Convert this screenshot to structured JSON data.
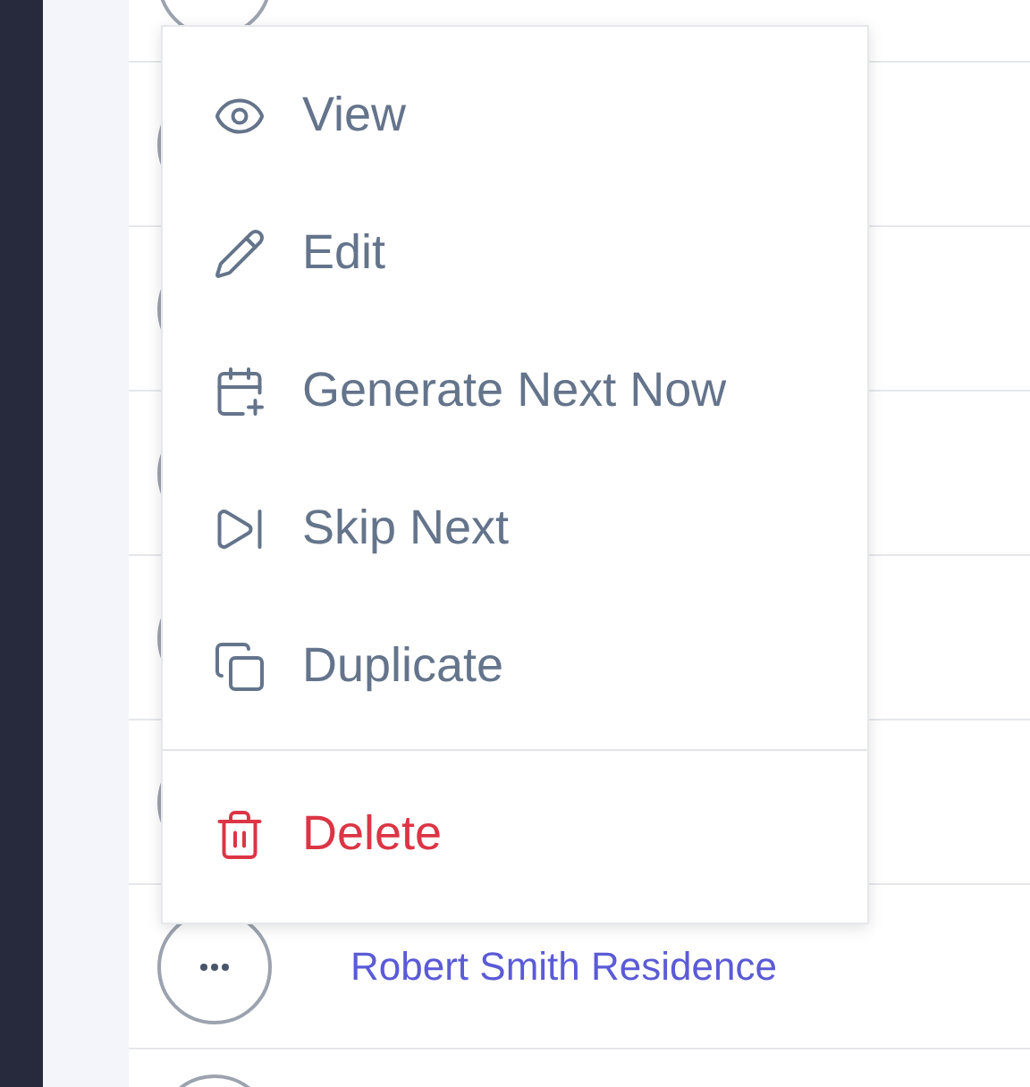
{
  "menu": {
    "items": [
      {
        "label": "View",
        "kind": "normal"
      },
      {
        "label": "Edit",
        "kind": "normal"
      },
      {
        "label": "Generate Next Now",
        "kind": "normal"
      },
      {
        "label": "Skip Next",
        "kind": "normal"
      },
      {
        "label": "Duplicate",
        "kind": "normal"
      },
      {
        "label": "Delete",
        "kind": "danger"
      }
    ]
  },
  "table": {
    "visible_row": {
      "name": "Robert Smith Residence"
    }
  }
}
